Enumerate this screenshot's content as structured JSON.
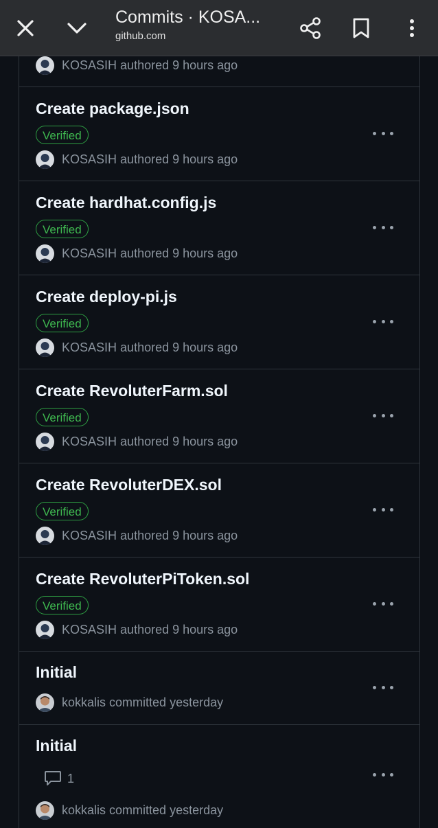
{
  "browser": {
    "title": "Commits · KOSA...",
    "url": "github.com",
    "icons": [
      "close-icon",
      "chevron-down-icon",
      "share-icon",
      "bookmark-icon",
      "more-vert-icon"
    ]
  },
  "verified_label": "Verified",
  "partial_commit": {
    "author": "KOSASIH",
    "meta": "authored 9 hours ago"
  },
  "commits": [
    {
      "title": "Create package.json",
      "author": "KOSASIH",
      "meta": "authored 9 hours ago"
    },
    {
      "title": "Create hardhat.config.js",
      "author": "KOSASIH",
      "meta": "authored 9 hours ago"
    },
    {
      "title": "Create deploy-pi.js",
      "author": "KOSASIH",
      "meta": "authored 9 hours ago"
    },
    {
      "title": "Create RevoluterFarm.sol",
      "author": "KOSASIH",
      "meta": "authored 9 hours ago"
    },
    {
      "title": "Create RevoluterDEX.sol",
      "author": "KOSASIH",
      "meta": "authored 9 hours ago"
    },
    {
      "title": "Create RevoluterPiToken.sol",
      "author": "KOSASIH",
      "meta": "authored 9 hours ago"
    },
    {
      "title": "Initial",
      "author": "kokkalis",
      "meta": "committed yesterday"
    },
    {
      "title": "Initial",
      "author": "kokkalis",
      "meta": "committed yesterday",
      "comments": "1"
    }
  ]
}
